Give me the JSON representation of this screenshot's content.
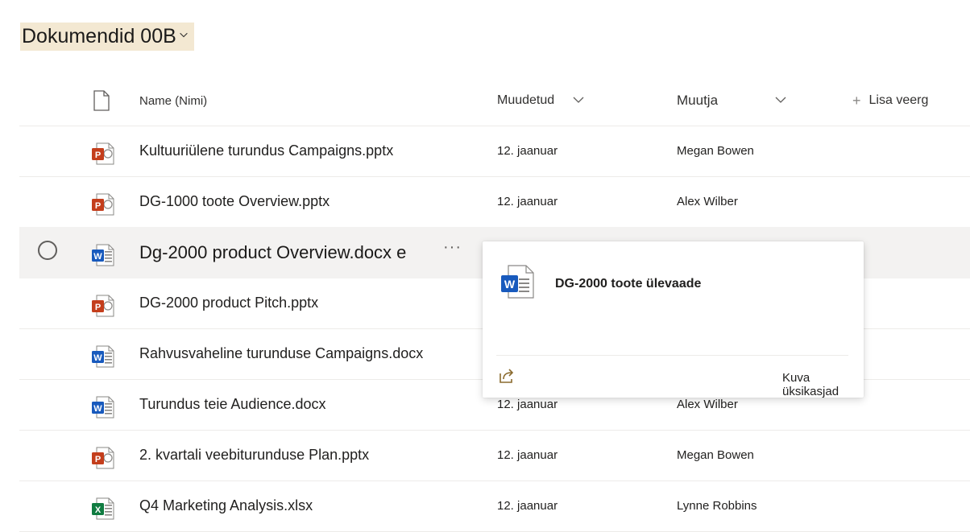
{
  "library": {
    "title": "Dokumendid 00B"
  },
  "columns": {
    "name": "Name (Nimi)",
    "modified": "Muudetud",
    "modified_by": "Muutja",
    "add_column": "Lisa veerg"
  },
  "files": [
    {
      "name": "Kultuuriülene turundus Campaigns.pptx",
      "type": "pptx",
      "modified": "12. jaanuar",
      "modified_by": "Megan Bowen"
    },
    {
      "name": "DG-1000 toote Overview.pptx",
      "type": "pptx",
      "modified": "12. jaanuar",
      "modified_by": "Alex Wilber"
    },
    {
      "name": "Dg-2000 product Overview.docx e",
      "type": "docx",
      "modified": "",
      "modified_by": ""
    },
    {
      "name": "DG-2000 product Pitch.pptx",
      "type": "pptx",
      "modified": "",
      "modified_by": ""
    },
    {
      "name": "Rahvusvaheline turunduse Campaigns.docx",
      "type": "docx",
      "modified": "",
      "modified_by": ""
    },
    {
      "name": "Turundus teie Audience.docx",
      "type": "docx",
      "modified": "12. jaanuar",
      "modified_by": "Alex Wilber"
    },
    {
      "name": "2. kvartali veebiturunduse Plan.pptx",
      "type": "pptx",
      "modified": "12. jaanuar",
      "modified_by": "Megan Bowen"
    },
    {
      "name": "Q4 Marketing Analysis.xlsx",
      "type": "xlsx",
      "modified": "12. jaanuar",
      "modified_by": "Lynne Robbins"
    }
  ],
  "selected_row_more": "···",
  "hovercard": {
    "title": "DG-2000 toote ülevaade",
    "details_link": "Kuva üksikasjad"
  },
  "colors": {
    "pptx": "#c43e1c",
    "docx": "#185abd",
    "xlsx": "#107c41",
    "title_highlight": "#f3e8d2",
    "share_icon": "#8a6a2e"
  }
}
